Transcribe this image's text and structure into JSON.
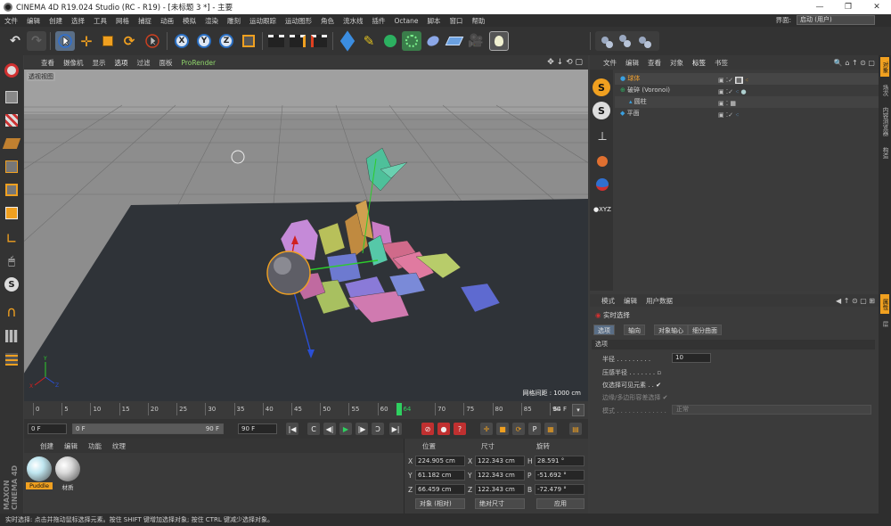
{
  "window": {
    "title": "CINEMA 4D R19.024 Studio (RC - R19) - [未标题 3 *] - 主要"
  },
  "menubar": {
    "items": [
      "文件",
      "编辑",
      "创建",
      "选择",
      "工具",
      "网格",
      "捕捉",
      "动画",
      "模拟",
      "渲染",
      "雕刻",
      "运动跟踪",
      "运动图形",
      "角色",
      "流水线",
      "插件",
      "Octane",
      "脚本",
      "窗口",
      "帮助"
    ],
    "layout_label": "界面:",
    "layout_value": "启动 (用户)"
  },
  "toolbar": {
    "axis_x": "X",
    "axis_y": "Y",
    "axis_z": "Z"
  },
  "viewport": {
    "menu": [
      "查看",
      "摄像机",
      "显示",
      "选项",
      "过滤",
      "面板",
      "ProRender"
    ],
    "label": "透视视图",
    "grid_spacing": "网格间距 : 1000 cm"
  },
  "timeline": {
    "ticks": [
      "0",
      "5",
      "10",
      "15",
      "20",
      "25",
      "30",
      "35",
      "40",
      "45",
      "50",
      "55",
      "60",
      "64",
      "70",
      "75",
      "80",
      "85",
      "90"
    ],
    "current_frame": "64",
    "end_label": "64 F",
    "playhead_percent": 71
  },
  "playbar": {
    "start_field": "0 F",
    "range_start": "0 F",
    "range_end": "90 F",
    "end_field": "90 F"
  },
  "materials": {
    "tabs": [
      "创建",
      "编辑",
      "功能",
      "纹理"
    ],
    "items": [
      {
        "name": "Puddle",
        "color": "#bfe6f0"
      },
      {
        "name": "材质",
        "color": "#d8d8d8"
      }
    ]
  },
  "coords": {
    "headers": [
      "位置",
      "尺寸",
      "旋转"
    ],
    "rows": [
      {
        "axis": "X",
        "pos": "224.905 cm",
        "size_axis": "X",
        "size": "122.343 cm",
        "rot_axis": "H",
        "rot": "28.591 °"
      },
      {
        "axis": "Y",
        "pos": "61.182 cm",
        "size_axis": "Y",
        "size": "122.343 cm",
        "rot_axis": "P",
        "rot": "-51.692 °"
      },
      {
        "axis": "Z",
        "pos": "66.459 cm",
        "size_axis": "Z",
        "size": "122.343 cm",
        "rot_axis": "B",
        "rot": "-72.479 °"
      }
    ],
    "mode": "对象 (相对)",
    "size_mode": "绝对尺寸",
    "apply": "应用"
  },
  "object_manager": {
    "menu": [
      "文件",
      "编辑",
      "查看",
      "对象",
      "标签",
      "书签"
    ],
    "objects": [
      {
        "name": "球体",
        "color": "#f0a030",
        "indent": 0
      },
      {
        "name": "破碎 (Voronoi)",
        "color": "#cfcfcf",
        "indent": 0
      },
      {
        "name": "圆柱",
        "color": "#cfcfcf",
        "indent": 1
      },
      {
        "name": "平面",
        "color": "#cfcfcf",
        "indent": 0
      }
    ]
  },
  "attributes": {
    "menu": [
      "模式",
      "编辑",
      "用户数据"
    ],
    "tool_name": "实时选择",
    "tabs": [
      "选项",
      "轴向",
      "对象轴心",
      "细分曲面"
    ],
    "section": "选项",
    "fields": [
      {
        "label": "半径",
        "value": "10"
      },
      {
        "label": "压感半径",
        "value": ""
      },
      {
        "label": "仅选择可见元素",
        "value": "✔"
      },
      {
        "label": "边缘/多边形容差选择",
        "value": "✔"
      },
      {
        "label": "模式",
        "value": "正常"
      }
    ]
  },
  "right_tabs": [
    "对象",
    "场次",
    "内容浏览器",
    "构造"
  ],
  "right_tabs_lower": [
    "属性",
    "层"
  ],
  "status": "实时选择: 点击并拖动鼠标选择元素。按住 SHIFT 键增加选择对象; 按住 CTRL 键减少选择对象。",
  "brand": "MAXON CINEMA 4D"
}
